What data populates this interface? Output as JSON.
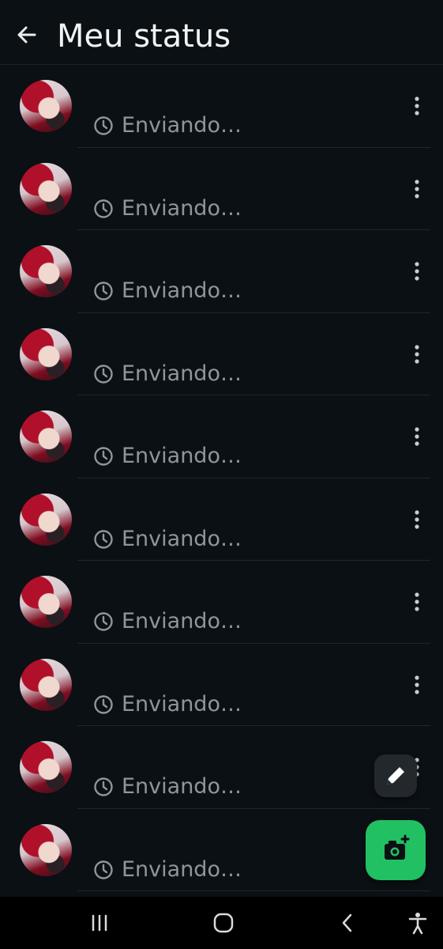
{
  "header": {
    "title": "Meu status",
    "back_icon": "arrow-back-icon"
  },
  "statuses": [
    {
      "status_text": "Enviando…",
      "status_icon": "clock-icon",
      "menu_icon": "more-vert-icon"
    },
    {
      "status_text": "Enviando…",
      "status_icon": "clock-icon",
      "menu_icon": "more-vert-icon"
    },
    {
      "status_text": "Enviando…",
      "status_icon": "clock-icon",
      "menu_icon": "more-vert-icon"
    },
    {
      "status_text": "Enviando…",
      "status_icon": "clock-icon",
      "menu_icon": "more-vert-icon"
    },
    {
      "status_text": "Enviando…",
      "status_icon": "clock-icon",
      "menu_icon": "more-vert-icon"
    },
    {
      "status_text": "Enviando…",
      "status_icon": "clock-icon",
      "menu_icon": "more-vert-icon"
    },
    {
      "status_text": "Enviando…",
      "status_icon": "clock-icon",
      "menu_icon": "more-vert-icon"
    },
    {
      "status_text": "Enviando…",
      "status_icon": "clock-icon",
      "menu_icon": "more-vert-icon"
    },
    {
      "status_text": "Enviando…",
      "status_icon": "clock-icon",
      "menu_icon": "more-vert-icon"
    },
    {
      "status_text": "Enviando…",
      "status_icon": "clock-icon",
      "menu_icon": "more-vert-icon"
    }
  ],
  "fabs": {
    "edit_icon": "pencil-icon",
    "camera_icon": "camera-add-icon"
  },
  "navbar": {
    "icons": [
      "recent-apps-icon",
      "home-icon",
      "back-icon",
      "accessibility-icon"
    ]
  },
  "colors": {
    "background": "#0b1014",
    "accent": "#21c063",
    "muted_text": "#8c979d"
  }
}
